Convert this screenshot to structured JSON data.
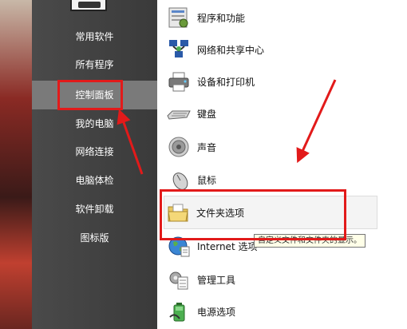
{
  "left_menu": {
    "items": [
      {
        "label": "常用软件"
      },
      {
        "label": "所有程序"
      },
      {
        "label": "控制面板"
      },
      {
        "label": "我的电脑"
      },
      {
        "label": "网络连接"
      },
      {
        "label": "电脑体检"
      },
      {
        "label": "软件卸载"
      },
      {
        "label": "图标版"
      }
    ],
    "active_label": "控制面板"
  },
  "control_panel": {
    "items": [
      {
        "label": "程序和功能",
        "icon": "programs-icon"
      },
      {
        "label": "网络和共享中心",
        "icon": "network-icon"
      },
      {
        "label": "设备和打印机",
        "icon": "printer-icon"
      },
      {
        "label": "键盘",
        "icon": "keyboard-icon"
      },
      {
        "label": "声音",
        "icon": "speaker-icon"
      },
      {
        "label": "鼠标",
        "icon": "mouse-icon"
      },
      {
        "label": "文件夹选项",
        "icon": "folder-icon"
      },
      {
        "label": "Internet 选项",
        "icon": "globe-icon"
      },
      {
        "label": "管理工具",
        "icon": "admin-tools-icon"
      },
      {
        "label": "电源选项",
        "icon": "battery-icon"
      }
    ],
    "tooltip": "自定义文件和文件夹的显示。"
  },
  "annotations": {
    "color": "#e21a1a"
  }
}
